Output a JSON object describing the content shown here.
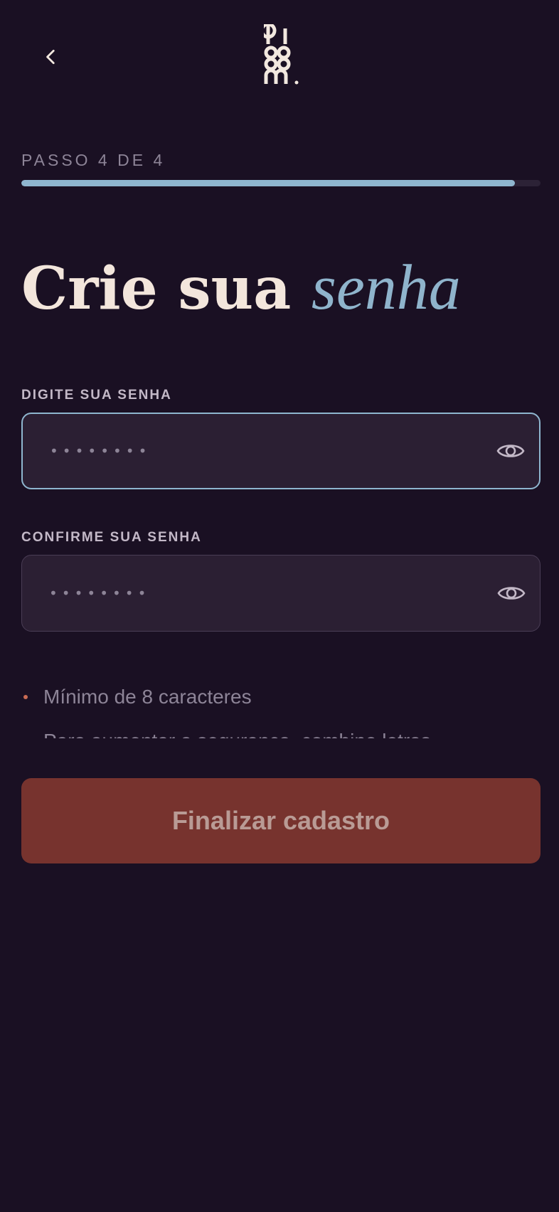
{
  "header": {
    "back_icon": "chevron-left-icon",
    "logo_text": "bloom."
  },
  "progress": {
    "step_label": "PASSO 4 DE 4",
    "fraction": 0.95
  },
  "title": {
    "main": "Crie sua",
    "accent": "senha"
  },
  "password": {
    "label": "DIGITE SUA SENHA",
    "placeholder": "••••••••",
    "toggle_icon": "eye-icon"
  },
  "confirm": {
    "label": "CONFIRME SUA SENHA",
    "placeholder": "••••••••",
    "toggle_icon": "eye-icon"
  },
  "rules": [
    "Mínimo de 8 caracteres",
    "Para aumentar a segurança, combine letras"
  ],
  "submit": {
    "label": "Finalizar cadastro"
  },
  "colors": {
    "background": "#1a1023",
    "accent_blue": "#8fb6cf",
    "button_bg": "#77332e",
    "bullet": "#c96b54"
  }
}
